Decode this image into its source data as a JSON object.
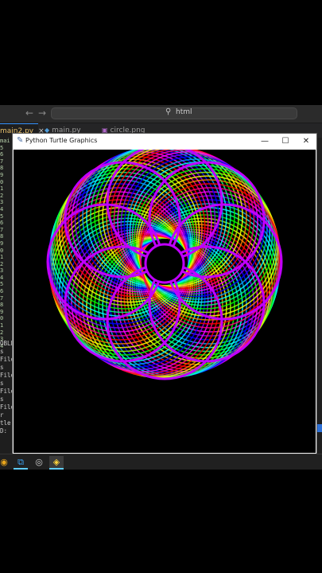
{
  "vscode": {
    "nav_back": "←",
    "nav_forward": "→",
    "search_icon": "⚲",
    "command_center_text": "html",
    "tabs": [
      {
        "label": "main2.py",
        "close": "×",
        "icon": "py-icon"
      },
      {
        "label": "main.py",
        "icon": "py-icon"
      },
      {
        "label": "circle.png",
        "icon": "image-icon"
      }
    ],
    "gutter_lines": [
      "mai",
      "5",
      "6",
      "7",
      "8",
      "9",
      "0",
      "1",
      "2",
      "3",
      "4",
      "5",
      "6",
      "7",
      "8",
      "9",
      "0",
      "1",
      "2",
      "3",
      "4",
      "5",
      "6",
      "7",
      "8",
      "9",
      "0",
      "1",
      "2",
      "3",
      "4"
    ],
    "terminal_lines": [
      "OBLEM",
      "",
      "s",
      "File",
      "s",
      "File",
      "s",
      "File",
      "s",
      "File",
      "r",
      "tle",
      "D:"
    ]
  },
  "turtle_window": {
    "title": "Python Turtle Graphics",
    "minimize_glyph": "—",
    "maximize_glyph": "☐",
    "close_glyph": "✕"
  },
  "taskbar": {
    "items": [
      "chrome-icon",
      "vscode-icon",
      "obs-icon",
      "python-icon"
    ]
  },
  "colors": {
    "rainbow": [
      "#ff00ff",
      "#7f00ff",
      "#0000ff",
      "#00a0ff",
      "#00ffff",
      "#00ff80",
      "#00ff00",
      "#a0ff00",
      "#ffff00",
      "#ff8000",
      "#ff0000",
      "#ff0080"
    ],
    "canvas_bg": "#000000"
  }
}
